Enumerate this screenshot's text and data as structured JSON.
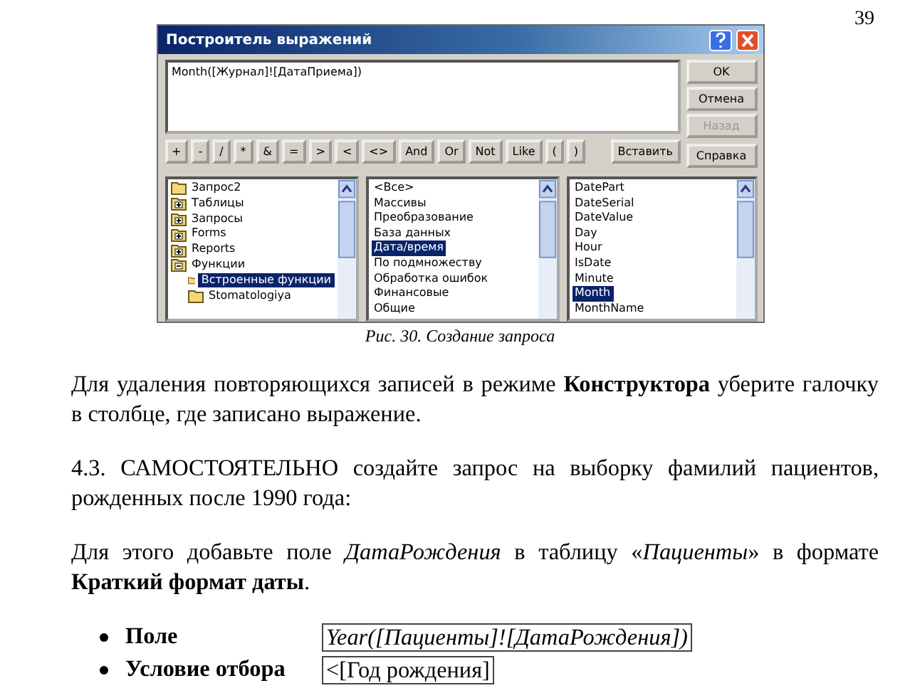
{
  "page_number": "39",
  "dialog": {
    "title": "Построитель выражений",
    "expression": "Month([Журнал]![ДатаПриема])",
    "side_buttons": [
      {
        "label": "OK",
        "disabled": false
      },
      {
        "label": "Отмена",
        "disabled": false
      },
      {
        "label": "Назад",
        "disabled": true
      }
    ],
    "operators": [
      "+",
      "-",
      "/",
      "*",
      "&",
      "=",
      ">",
      "<",
      "<>",
      "And",
      "Or",
      "Not",
      "Like",
      "(",
      ")"
    ],
    "insert_button": "Вставить",
    "help_button": "Справка",
    "tree": [
      {
        "label": "Запрос2",
        "kind": "leaf",
        "selected": false
      },
      {
        "label": "Таблицы",
        "kind": "group",
        "expanded": false,
        "selected": false
      },
      {
        "label": "Запросы",
        "kind": "group",
        "expanded": false,
        "selected": false
      },
      {
        "label": "Forms",
        "kind": "group",
        "expanded": false,
        "selected": false
      },
      {
        "label": "Reports",
        "kind": "group",
        "expanded": false,
        "selected": false
      },
      {
        "label": "Функции",
        "kind": "group",
        "expanded": true,
        "selected": false,
        "children": [
          {
            "label": "Встроенные функции",
            "kind": "leaf",
            "selected": true
          },
          {
            "label": "Stomatologiya",
            "kind": "leaf",
            "selected": false
          }
        ]
      }
    ],
    "categories": [
      {
        "label": "<Все>",
        "selected": false
      },
      {
        "label": "Массивы",
        "selected": false
      },
      {
        "label": "Преобразование",
        "selected": false
      },
      {
        "label": "База данных",
        "selected": false
      },
      {
        "label": "Дата/время",
        "selected": true
      },
      {
        "label": "По подмножеству",
        "selected": false
      },
      {
        "label": "Обработка ошибок",
        "selected": false
      },
      {
        "label": "Финансовые",
        "selected": false
      },
      {
        "label": "Общие",
        "selected": false
      }
    ],
    "functions": [
      {
        "label": "DatePart",
        "selected": false
      },
      {
        "label": "DateSerial",
        "selected": false
      },
      {
        "label": "DateValue",
        "selected": false
      },
      {
        "label": "Day",
        "selected": false
      },
      {
        "label": "Hour",
        "selected": false
      },
      {
        "label": "IsDate",
        "selected": false
      },
      {
        "label": "Minute",
        "selected": false
      },
      {
        "label": "Month",
        "selected": true
      },
      {
        "label": "MonthName",
        "selected": false
      }
    ]
  },
  "caption": "Рис. 30. Создание запроса",
  "paragraphs": [
    "Для удаления повторяющихся записей в режиме **Конструктора** уберите галочку в столбце, где записано выражение.",
    "4.3. САМОСТОЯТЕЛЬНО создайте запрос на выборку фамилий пациентов, рожденных после 1990 года:",
    "Для этого добавьте поле *ДатаРождения* в таблицу «*Пациенты*» в формате **Краткий формат даты**."
  ],
  "bullets": [
    {
      "label": "Поле",
      "value": "Year([Пациенты]![ДатаРождения])",
      "kind": "italic"
    },
    {
      "label": "Условие отбора",
      "value": "<[Год рождения]",
      "kind": "plain"
    }
  ]
}
